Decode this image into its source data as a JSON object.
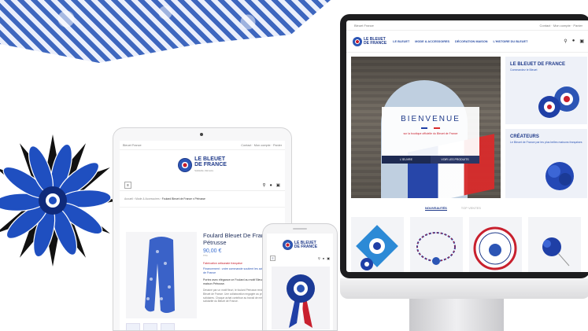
{
  "colors": {
    "brand_blue": "#1f3a8a",
    "accent_blue": "#2c55b5",
    "brand_red": "#c8202e",
    "dark_navy": "#1d2a52"
  },
  "brand": {
    "line1": "LE BLEUET",
    "line2": "DE FRANCE",
    "tagline": "Solidarité, Mémoire"
  },
  "desktop": {
    "topbar_left": "Bleuet France",
    "topbar_right": "Contact · Mon compte · Panier",
    "nav": [
      "LE BLEUET",
      "MODE & ACCESSOIRES",
      "DÉCORATION MAISON",
      "L'HISTOIRE DU BLEUET"
    ],
    "icons": [
      "search-icon",
      "user-icon",
      "cart-icon"
    ],
    "hero": {
      "title": "BIENVENUE",
      "subtitle": "sur la boutique officielle du Bleuet de France",
      "button_left": "L'ŒUVRE",
      "button_right": "VOIR LES PRODUITS"
    },
    "cards": [
      {
        "title": "LE BLEUET DE FRANCE",
        "text": "Commandez le Bleuet"
      },
      {
        "title": "CRÉATEURS",
        "text": "Le Bleuet de France par les plus belles maisons françaises"
      }
    ],
    "tabs": {
      "active": "NOUVEAUTÉS",
      "inactive": "TOP VENTES"
    },
    "products": [
      "cockade-product",
      "bracelet-product",
      "badge-product",
      "pin-product"
    ]
  },
  "tablet": {
    "topbar_left": "Bleuet France",
    "topbar_right": "Contact · Mon compte · Panier",
    "breadcrumb": [
      "Accueil",
      "Mode & Accessoires"
    ],
    "breadcrumb_current": "Foulard Bleuet de France x Pétrusse",
    "product": {
      "name": "Foulard Bleuet De France X Pétrusse",
      "price": "90,00 €",
      "tax": "TTC",
      "tag_made": "Fabrication artisanale française",
      "tag_support": "Financement : votre commande soutient les actions du Bleuet de France",
      "description": "Portez avec élégance ce Foulard au motif Bleuet créé par la maison Pétrusse.",
      "description_more": "Dessiné par un motif fleuri, le foulard Pétrusse rend hommage au Bleuet de France. Une collaboration engagée au profit des actions solidaires. Chaque achat contribue au travail de mémoire et de solidarité du Bleuet de France."
    }
  },
  "phone": {
    "icons": [
      "menu-icon",
      "search-icon",
      "user-icon",
      "cart-icon"
    ]
  }
}
